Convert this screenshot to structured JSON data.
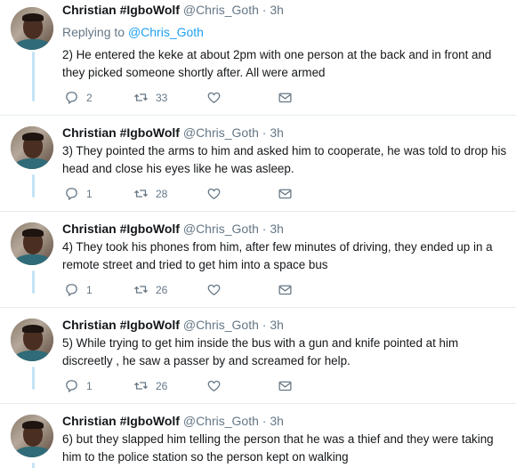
{
  "tweets": [
    {
      "name": "Christian #IgboWolf",
      "handle": "@Chris_Goth",
      "dot": "·",
      "time": "3h",
      "replying_prefix": "Replying to ",
      "replying_handle": "@Chris_Goth",
      "text": "2) He entered the keke at about 2pm with one person at the back and in front and they picked someone shortly after. All were armed",
      "replies": "2",
      "retweets": "33",
      "likes": ""
    },
    {
      "name": "Christian #IgboWolf",
      "handle": "@Chris_Goth",
      "dot": "·",
      "time": "3h",
      "text": "3) They pointed the arms to him and asked him to cooperate, he was told to drop his head and close his eyes like he was asleep.",
      "replies": "1",
      "retweets": "28",
      "likes": ""
    },
    {
      "name": "Christian #IgboWolf",
      "handle": "@Chris_Goth",
      "dot": "·",
      "time": "3h",
      "text": "4) They took his phones from him, after few minutes of driving, they ended up in a remote street and tried to get  him into a space bus",
      "replies": "1",
      "retweets": "26",
      "likes": ""
    },
    {
      "name": "Christian #IgboWolf",
      "handle": "@Chris_Goth",
      "dot": "·",
      "time": "3h",
      "text": "5) While trying to get him inside the bus with a gun and knife pointed at him discreetly , he saw a passer by and screamed for help.",
      "replies": "1",
      "retweets": "26",
      "likes": ""
    },
    {
      "name": "Christian #IgboWolf",
      "handle": "@Chris_Goth",
      "dot": "·",
      "time": "3h",
      "text": "6) but they slapped him telling the person that he was a thief and they were taking him to the police station so the person kept on walking"
    }
  ],
  "colors": {
    "thread_line": "#c4e3f3",
    "link": "#1da1f2",
    "muted": "#657786",
    "divider": "#e6ecf0"
  },
  "icons": {
    "reply": "reply-icon",
    "retweet": "retweet-icon",
    "like": "heart-icon",
    "dm": "envelope-icon"
  }
}
